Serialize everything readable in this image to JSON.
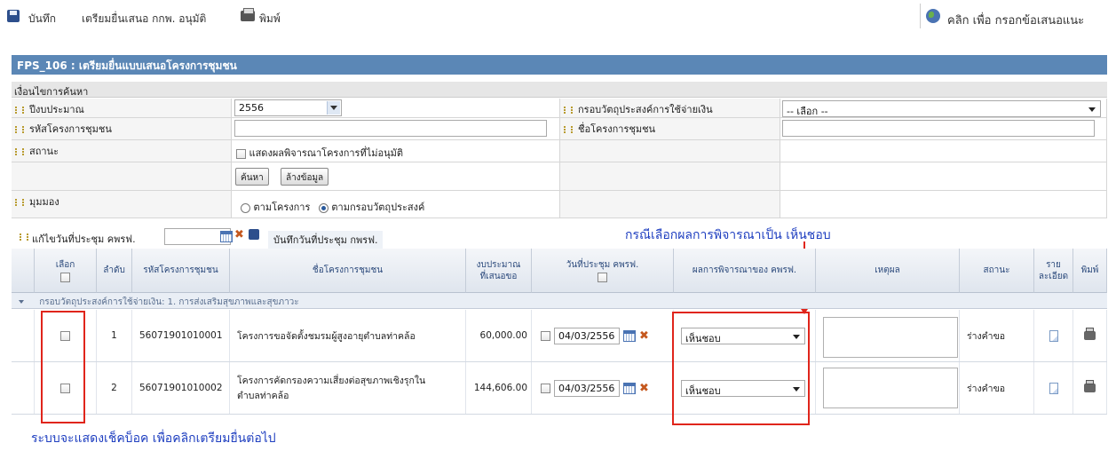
{
  "toolbar": {
    "save_label": "บันทึก",
    "prepare_label": "เตรียมยื่นเสนอ กกพ. อนุมัติ",
    "print_label": "พิมพ์",
    "feedback_label": "คลิก เพื่อ กรอกข้อเสนอแนะ"
  },
  "form": {
    "title": "FPS_106 : เตรียมยื่นแบบเสนอโครงการชุมชน",
    "criteria_heading": "เงื่อนไขการค้นหา",
    "fiscal_year_label": "ปีงบประมาณ",
    "fiscal_year_value": "2556",
    "objective_label": "กรอบวัตถุประสงค์การใช้จ่ายเงิน",
    "objective_value": "-- เลือก --",
    "project_code_label": "รหัสโครงการชุมชน",
    "project_name_label": "ชื่อโครงการชุมชน",
    "status_label": "สถานะ",
    "show_unapproved_label": "แสดงผลพิจารณาโครงการที่ไม่อนุมัติ",
    "search_button": "ค้นหา",
    "clear_button": "ล้างข้อมูล",
    "view_label": "มุมมอง",
    "view_by_project": "ตามโครงการ",
    "view_by_objective": "ตามกรอบวัตถุประสงค์",
    "meeting_date_edit_label": "แก้ไขวันที่ประชุม คพรฟ.",
    "save_meeting_date_label": "บันทึกวันที่ประชุม กพรฟ."
  },
  "table": {
    "headers": {
      "select": "เลือก",
      "seq": "ลำดับ",
      "code": "รหัสโครงการชุมชน",
      "name": "ชื่อโครงการชุมชน",
      "budget_1": "งบประมาณ",
      "budget_2": "ที่เสนอขอ",
      "meeting_date": "วันที่ประชุม คพรฟ.",
      "result": "ผลการพิจารณาของ คพรฟ.",
      "reason": "เหตุผล",
      "status": "สถานะ",
      "detail_1": "ราย",
      "detail_2": "ละเอียด",
      "print": "พิมพ์"
    },
    "group_label": "กรอบวัตถุประสงค์การใช้จ่ายเงิน: 1. การส่งเสริมสุขภาพและสุขภาวะ",
    "rows": [
      {
        "seq": "1",
        "code": "56071901010001",
        "name_1": "โครงการขอจัดตั้งชมรมผู้สูงอายุตำบลท่าคล้อ",
        "name_2": "",
        "budget": "60,000.00",
        "meeting_date": "04/03/2556",
        "result": "เห็นชอบ",
        "status": "ร่างคำขอ"
      },
      {
        "seq": "2",
        "code": "56071901010002",
        "name_1": "โครงการคัดกรองความเสี่ยงต่อสุขภาพเชิงรุกใน",
        "name_2": "ตำบลท่าคล้อ",
        "budget": "144,606.00",
        "meeting_date": "04/03/2556",
        "result": "เห็นชอบ",
        "status": "ร่างคำขอ"
      }
    ]
  },
  "annotations": {
    "top_note": "กรณีเลือกผลการพิจารณาเป็น เห็นชอบ",
    "bottom_note": "ระบบจะแสดงเช็คบ็อค เพื่อคลิกเตรียมยื่นต่อไป"
  },
  "colors": {
    "title_bar": "#5b87b6",
    "annotation_red": "#e0251b",
    "annotation_blue": "#1f3fc0"
  }
}
